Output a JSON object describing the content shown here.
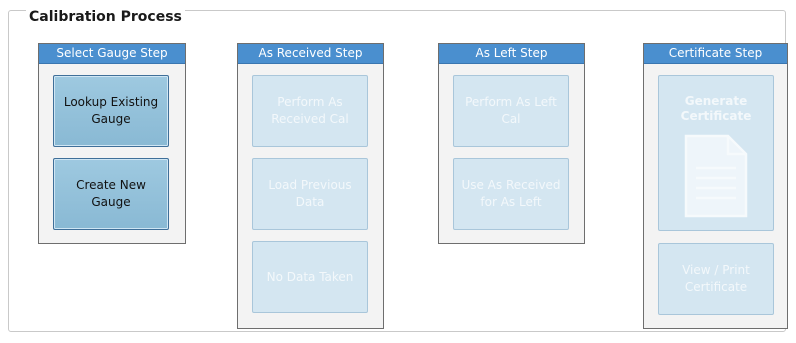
{
  "group": {
    "title": "Calibration Process"
  },
  "panels": {
    "select_gauge": {
      "header": "Select Gauge Step",
      "buttons": [
        "Lookup Existing Gauge",
        "Create New Gauge"
      ]
    },
    "as_received": {
      "header": "As Received Step",
      "buttons": [
        "Perform As Received Cal",
        "Load Previous Data",
        "No Data Taken"
      ]
    },
    "as_left": {
      "header": "As Left Step",
      "buttons": [
        "Perform As Left Cal",
        "Use As Received for As Left"
      ]
    },
    "certificate": {
      "header": "Certificate Step",
      "generate": "Generate Certificate",
      "view_print": "View / Print Certificate",
      "icon": "document-icon"
    }
  }
}
